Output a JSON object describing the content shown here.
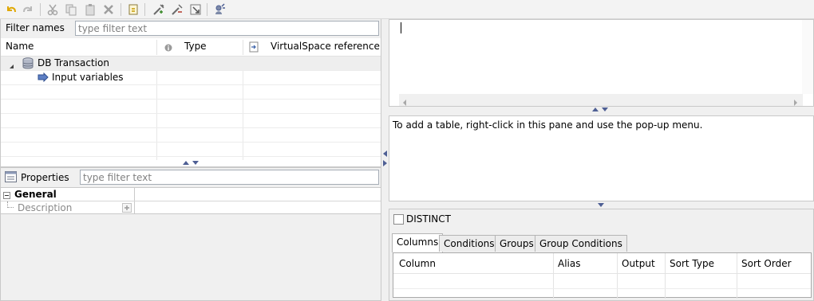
{
  "toolbar": {
    "icons": [
      "undo-icon",
      "redo-icon",
      "cut-icon",
      "copy-icon",
      "paste-icon",
      "delete-icon",
      "replace-icon",
      "add-join-icon",
      "remove-join-icon",
      "select-all-icon",
      "run-icon"
    ]
  },
  "left_top": {
    "filter_label": "Filter names",
    "filter_placeholder": "type filter text",
    "columns": [
      "Name",
      "Type",
      "VirtualSpace reference"
    ],
    "tree": {
      "root": "DB Transaction",
      "child": "Input variables"
    }
  },
  "properties": {
    "title": "Properties",
    "filter_placeholder": "type filter text",
    "section": "General",
    "rows": [
      {
        "label": "Description"
      }
    ]
  },
  "table_pane": {
    "hint": "To add a table, right-click in this pane and use the pop-up menu."
  },
  "bottom_right": {
    "distinct_label": "DISTINCT",
    "tabs": [
      "Columns",
      "Conditions",
      "Groups",
      "Group Conditions"
    ],
    "active_tab": "Columns",
    "columns": [
      "Column",
      "Alias",
      "Output",
      "Sort Type",
      "Sort Order"
    ]
  },
  "colors": {
    "accent": "#4e5f94",
    "border": "#c9c9c9",
    "panel_bg": "#f0f0f0"
  }
}
